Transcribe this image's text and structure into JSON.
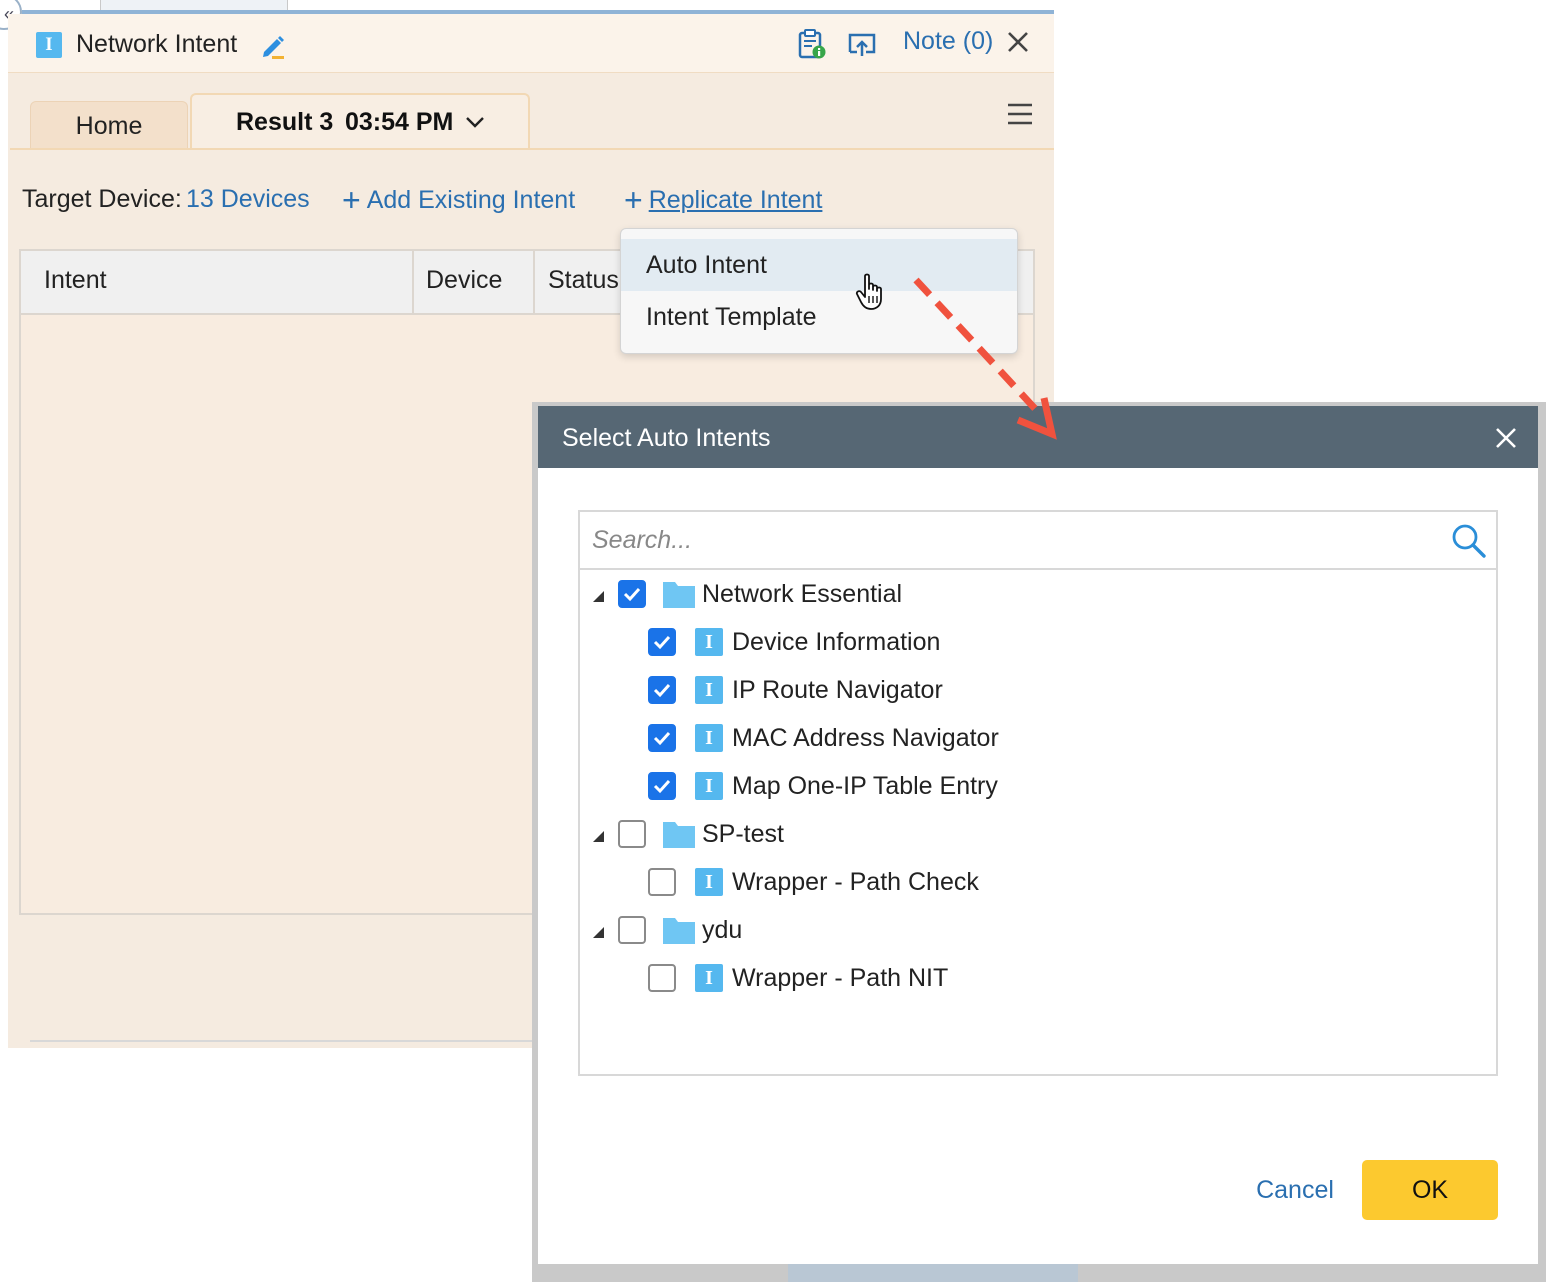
{
  "app": {
    "title": "Network Intent",
    "note_link": "Note (0)"
  },
  "tabs": [
    {
      "label": "Home"
    },
    {
      "label": "Result 3",
      "time": "03:54 PM",
      "active": true
    }
  ],
  "toolbar": {
    "target_label": "Target Device:",
    "target_value": "13 Devices",
    "add_existing": "Add Existing Intent",
    "replicate": "Replicate Intent"
  },
  "table": {
    "columns": [
      "Intent",
      "Device",
      "Status"
    ]
  },
  "replicate_menu": {
    "items": [
      "Auto Intent",
      "Intent Template"
    ],
    "hovered": "Auto Intent"
  },
  "dialog": {
    "title": "Select Auto Intents",
    "search_placeholder": "Search...",
    "tree": [
      {
        "label": "Network Essential",
        "type": "folder",
        "checked": true,
        "expanded": true,
        "children": [
          {
            "label": "Device Information",
            "checked": true
          },
          {
            "label": "IP Route Navigator",
            "checked": true
          },
          {
            "label": "MAC Address Navigator",
            "checked": true
          },
          {
            "label": "Map One-IP Table Entry",
            "checked": true
          }
        ]
      },
      {
        "label": "SP-test",
        "type": "folder",
        "checked": false,
        "expanded": true,
        "children": [
          {
            "label": "Wrapper - Path Check",
            "checked": false
          }
        ]
      },
      {
        "label": "ydu",
        "type": "folder",
        "checked": false,
        "expanded": true,
        "children": [
          {
            "label": "Wrapper - Path NIT",
            "checked": false
          }
        ]
      }
    ],
    "cancel_label": "Cancel",
    "ok_label": "OK"
  },
  "icons": {
    "app": "I",
    "intent": "I"
  },
  "colors": {
    "link": "#2a6fb0",
    "dialog_header": "#566774",
    "ok_button": "#fcc92f",
    "checkbox_checked": "#1a73e8",
    "arrow": "#f0523e"
  }
}
